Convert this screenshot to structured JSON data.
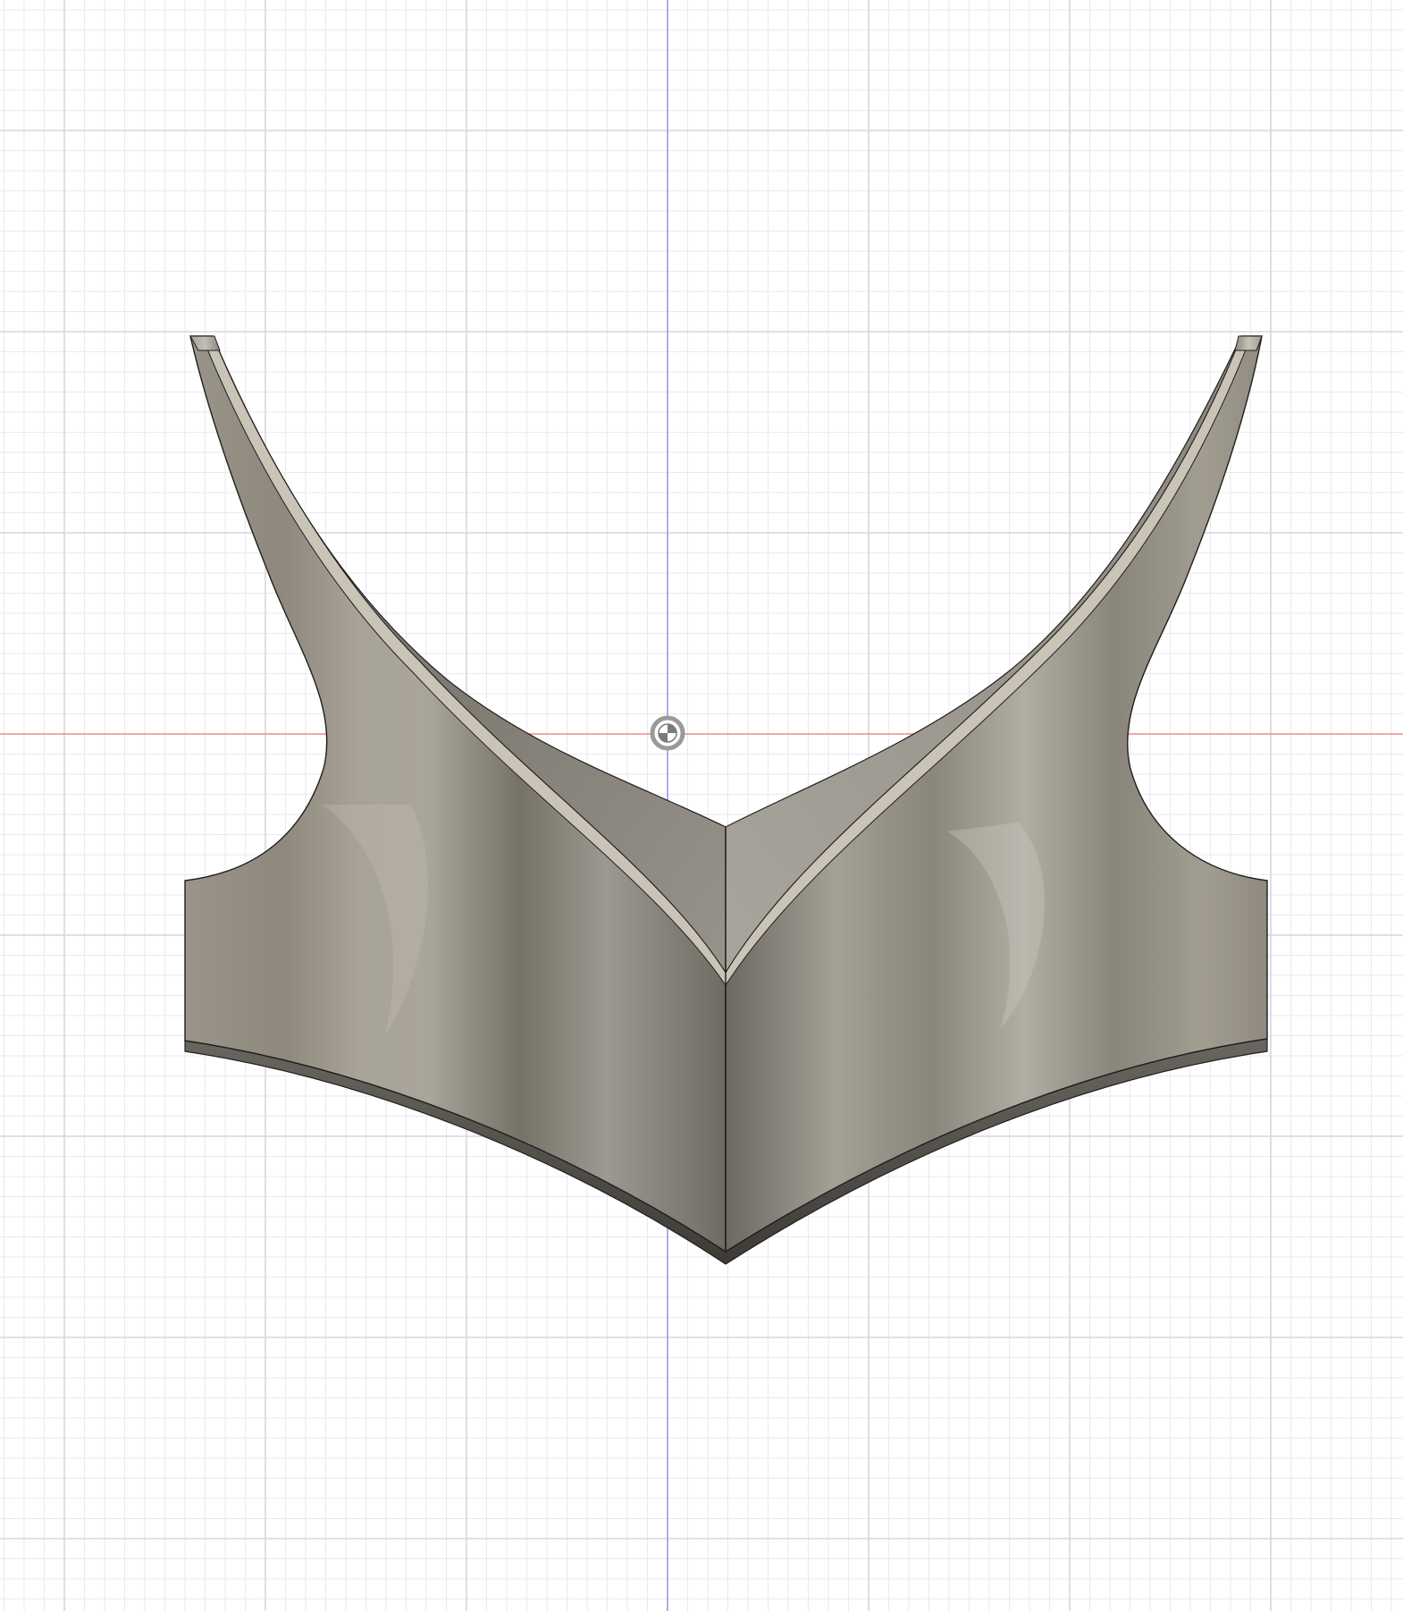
{
  "viewport": {
    "background_color": "#ffffff",
    "grid_minor_color": "#e9e9ef",
    "grid_major_color": "#d6d6de",
    "axis_x_color": "#f08a8a",
    "axis_y_color": "#9a9ae8",
    "model_base_color": "#8a8479",
    "model_highlight_color": "#b9b4aa",
    "model_shadow_color": "#5f5b55",
    "model_edge_color": "#1f1f1f",
    "model_rim_color": "#c9c4b6"
  },
  "origin_marker": {
    "icon": "origin-point-icon"
  }
}
